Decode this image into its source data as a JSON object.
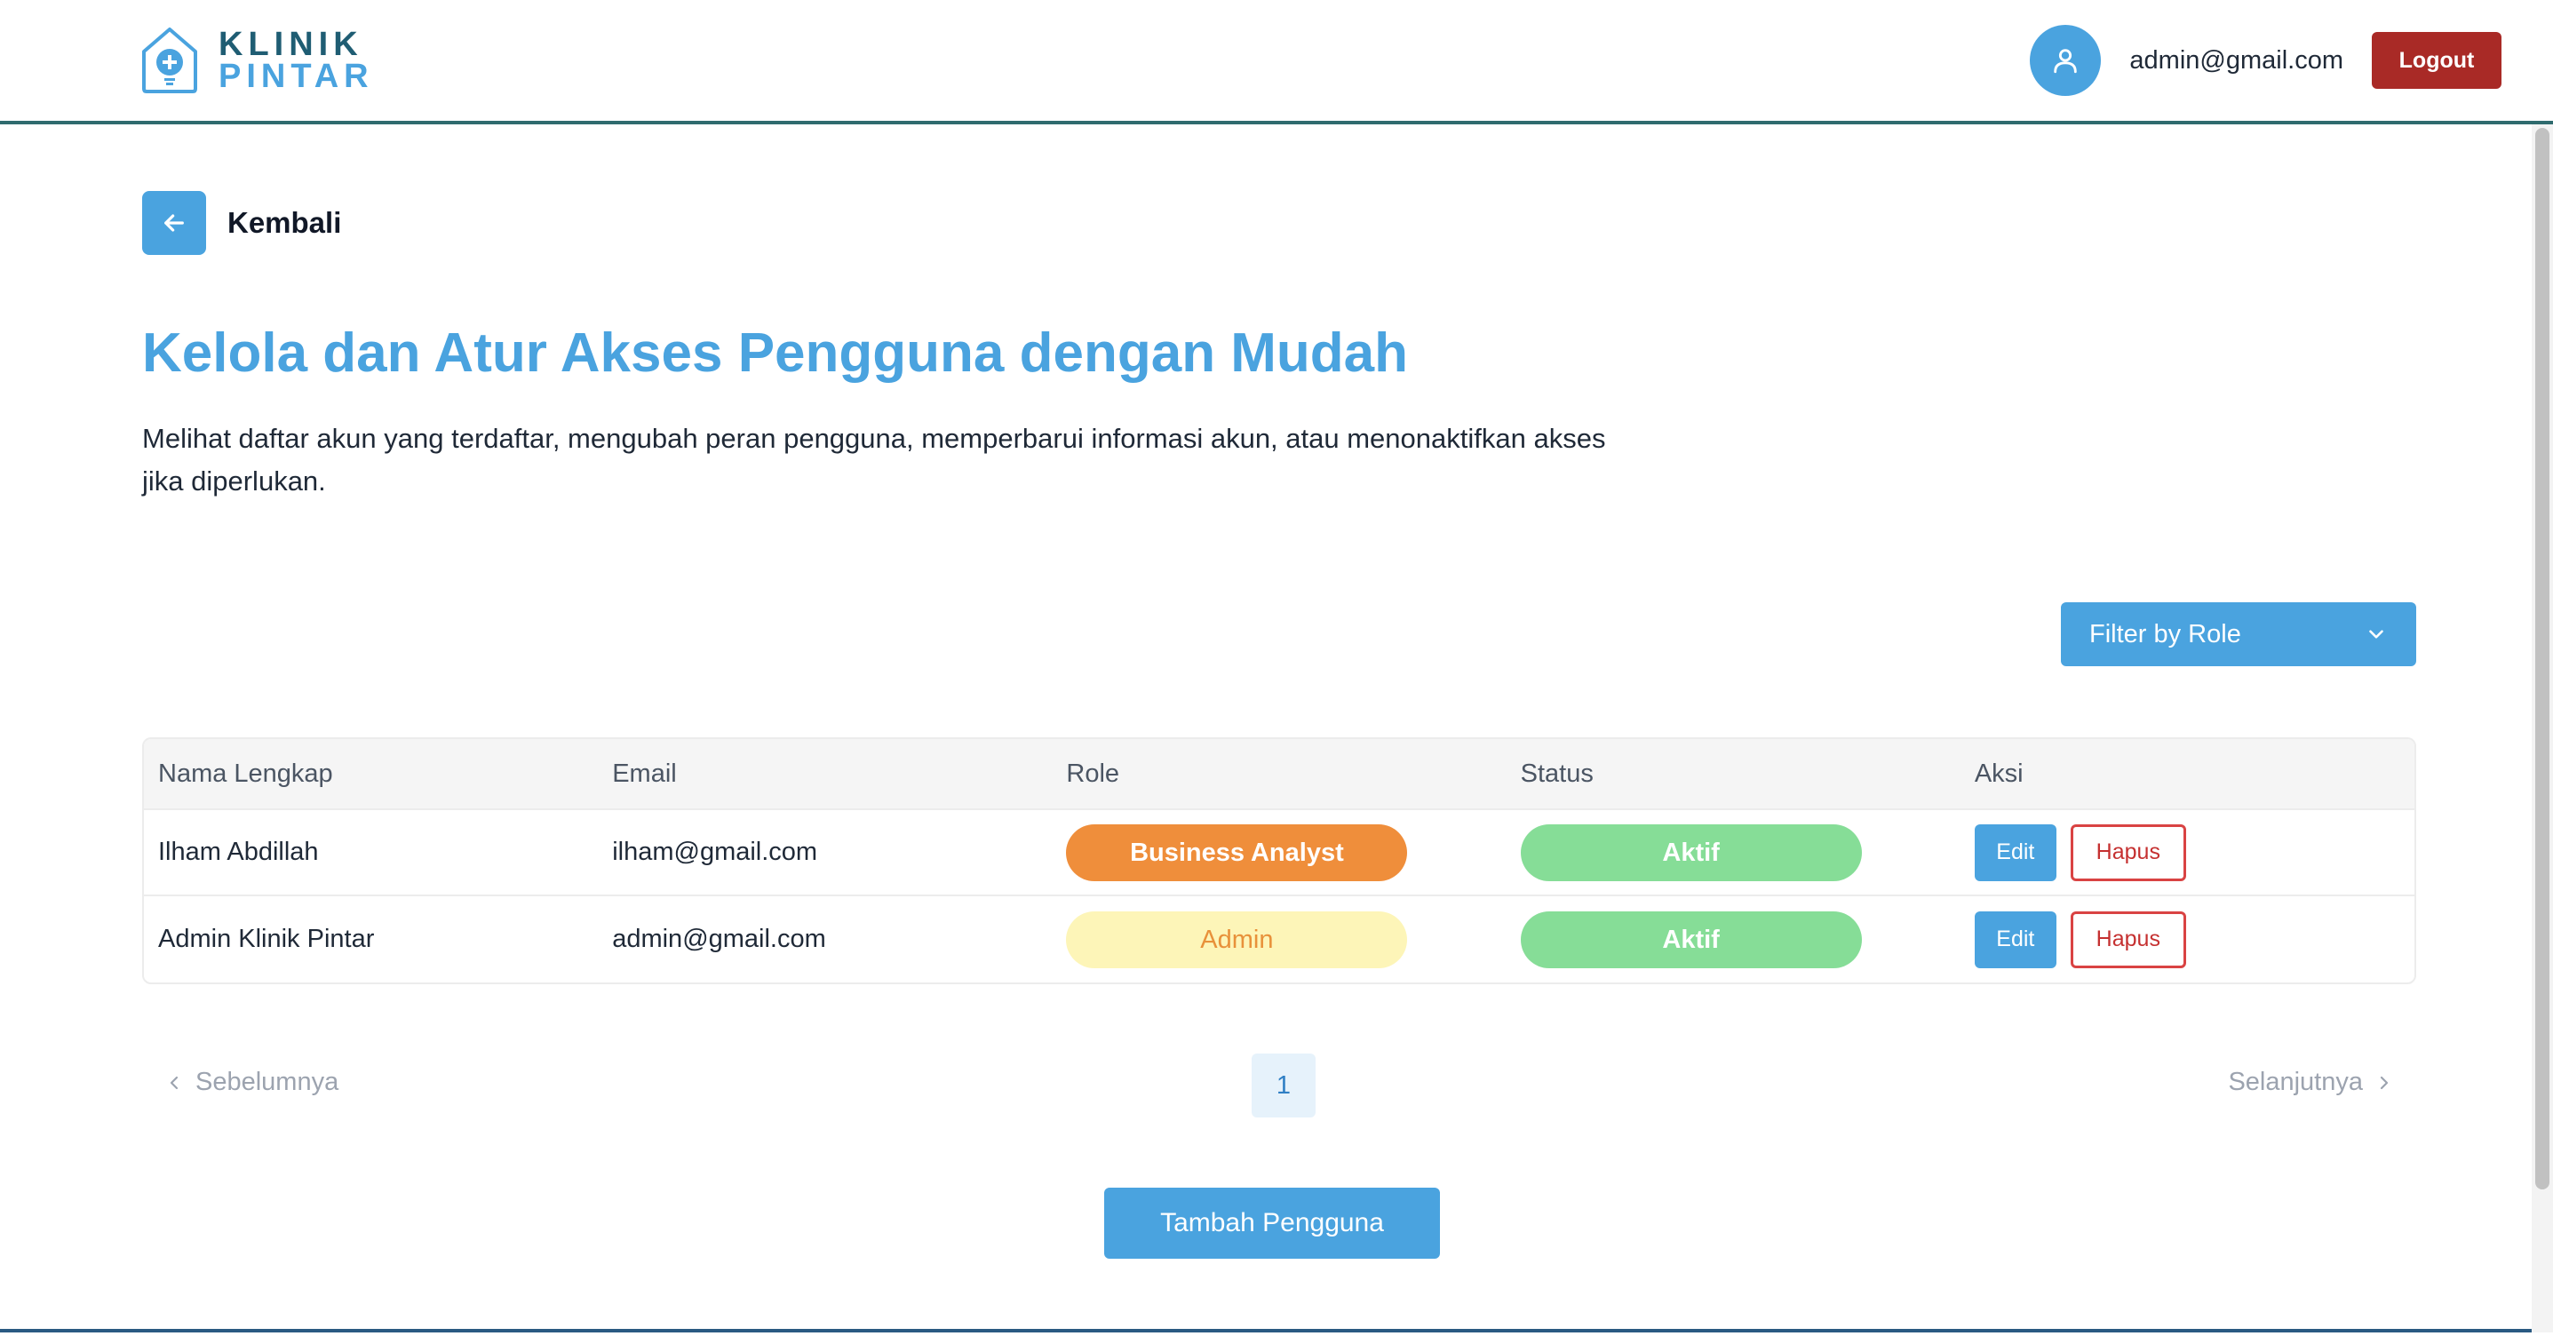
{
  "header": {
    "logo_line1": "KLINIK",
    "logo_line2": "PINTAR",
    "user_email": "admin@gmail.com",
    "logout_label": "Logout"
  },
  "back": {
    "label": "Kembali"
  },
  "page": {
    "title": "Kelola dan Atur Akses Pengguna dengan Mudah",
    "description": "Melihat daftar akun yang terdaftar, mengubah peran pengguna, memperbarui informasi akun, atau menonaktifkan akses jika diperlukan."
  },
  "filter": {
    "label": "Filter by Role"
  },
  "table": {
    "columns": [
      "Nama Lengkap",
      "Email",
      "Role",
      "Status",
      "Aksi"
    ],
    "rows": [
      {
        "name": "Ilham Abdillah",
        "email": "ilham@gmail.com",
        "role": "Business Analyst",
        "status": "Aktif",
        "edit": "Edit",
        "delete": "Hapus"
      },
      {
        "name": "Admin Klinik Pintar",
        "email": "admin@gmail.com",
        "role": "Admin",
        "status": "Aktif",
        "edit": "Edit",
        "delete": "Hapus"
      }
    ]
  },
  "pagination": {
    "prev_label": "Sebelumnya",
    "next_label": "Selanjutnya",
    "current_page": "1"
  },
  "add_button": {
    "label": "Tambah Pengguna"
  },
  "colors": {
    "primary": "#4aa3df",
    "logout": "#a92a26",
    "role_business_analyst": "#ef8e3b",
    "role_admin_bg": "#fdf5b8",
    "status_active": "#86dd97",
    "delete": "#d94343"
  },
  "icons": {
    "logo": "clinic-house-plus-icon",
    "avatar": "user-icon",
    "back": "arrow-left-icon",
    "filter": "chevron-down-icon",
    "prev": "chevron-left-icon",
    "next": "chevron-right-icon"
  }
}
